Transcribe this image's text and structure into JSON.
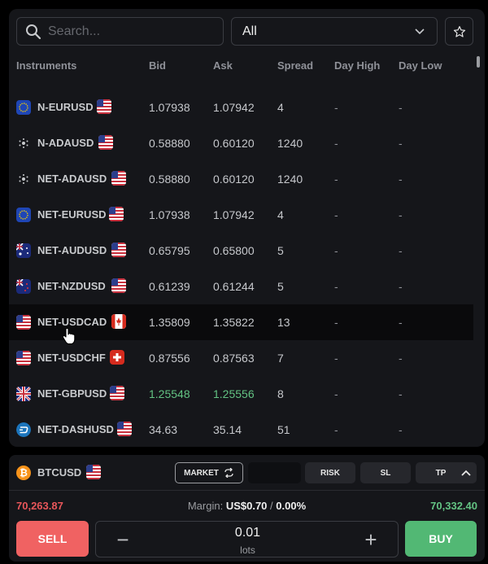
{
  "search": {
    "placeholder": "Search...",
    "value": ""
  },
  "filter": {
    "selected": "All"
  },
  "table": {
    "headers": [
      "Instruments",
      "Bid",
      "Ask",
      "Spread",
      "Day High",
      "Day Low"
    ],
    "rows": [
      {
        "symbol": "N-EURUSD",
        "bid": "1.07938",
        "ask": "1.07942",
        "spread": "4",
        "high": "-",
        "low": "-"
      },
      {
        "symbol": "N-ADAUSD",
        "bid": "0.58880",
        "ask": "0.60120",
        "spread": "1240",
        "high": "-",
        "low": "-"
      },
      {
        "symbol": "NET-ADAUSD",
        "bid": "0.58880",
        "ask": "0.60120",
        "spread": "1240",
        "high": "-",
        "low": "-"
      },
      {
        "symbol": "NET-EURUSD",
        "bid": "1.07938",
        "ask": "1.07942",
        "spread": "4",
        "high": "-",
        "low": "-"
      },
      {
        "symbol": "NET-AUDUSD",
        "bid": "0.65795",
        "ask": "0.65800",
        "spread": "5",
        "high": "-",
        "low": "-"
      },
      {
        "symbol": "NET-NZDUSD",
        "bid": "0.61239",
        "ask": "0.61244",
        "spread": "5",
        "high": "-",
        "low": "-"
      },
      {
        "symbol": "NET-USDCAD",
        "bid": "1.35809",
        "ask": "1.35822",
        "spread": "13",
        "high": "-",
        "low": "-"
      },
      {
        "symbol": "NET-USDCHF",
        "bid": "0.87556",
        "ask": "0.87563",
        "spread": "7",
        "high": "-",
        "low": "-"
      },
      {
        "symbol": "NET-GBPUSD",
        "bid": "1.25548",
        "ask": "1.25556",
        "spread": "8",
        "high": "-",
        "low": "-"
      },
      {
        "symbol": "NET-DASHUSD",
        "bid": "34.63",
        "ask": "35.14",
        "spread": "51",
        "high": "-",
        "low": "-"
      }
    ]
  },
  "trade": {
    "symbol": "BTCUSD",
    "order_type": "MARKET",
    "risk_label": "RISK",
    "sl_label": "SL",
    "tp_label": "TP",
    "sell_price": "70,263.87",
    "buy_price": "70,332.40",
    "margin_label": "Margin:",
    "margin_value": "US$0.70",
    "margin_sep": "/",
    "margin_pct": "0.00%",
    "sell_label": "SELL",
    "buy_label": "BUY",
    "quantity": "0.01",
    "unit": "lots"
  },
  "colors": {
    "sell": "#f06262",
    "buy": "#52b874",
    "up": "#63c383"
  }
}
